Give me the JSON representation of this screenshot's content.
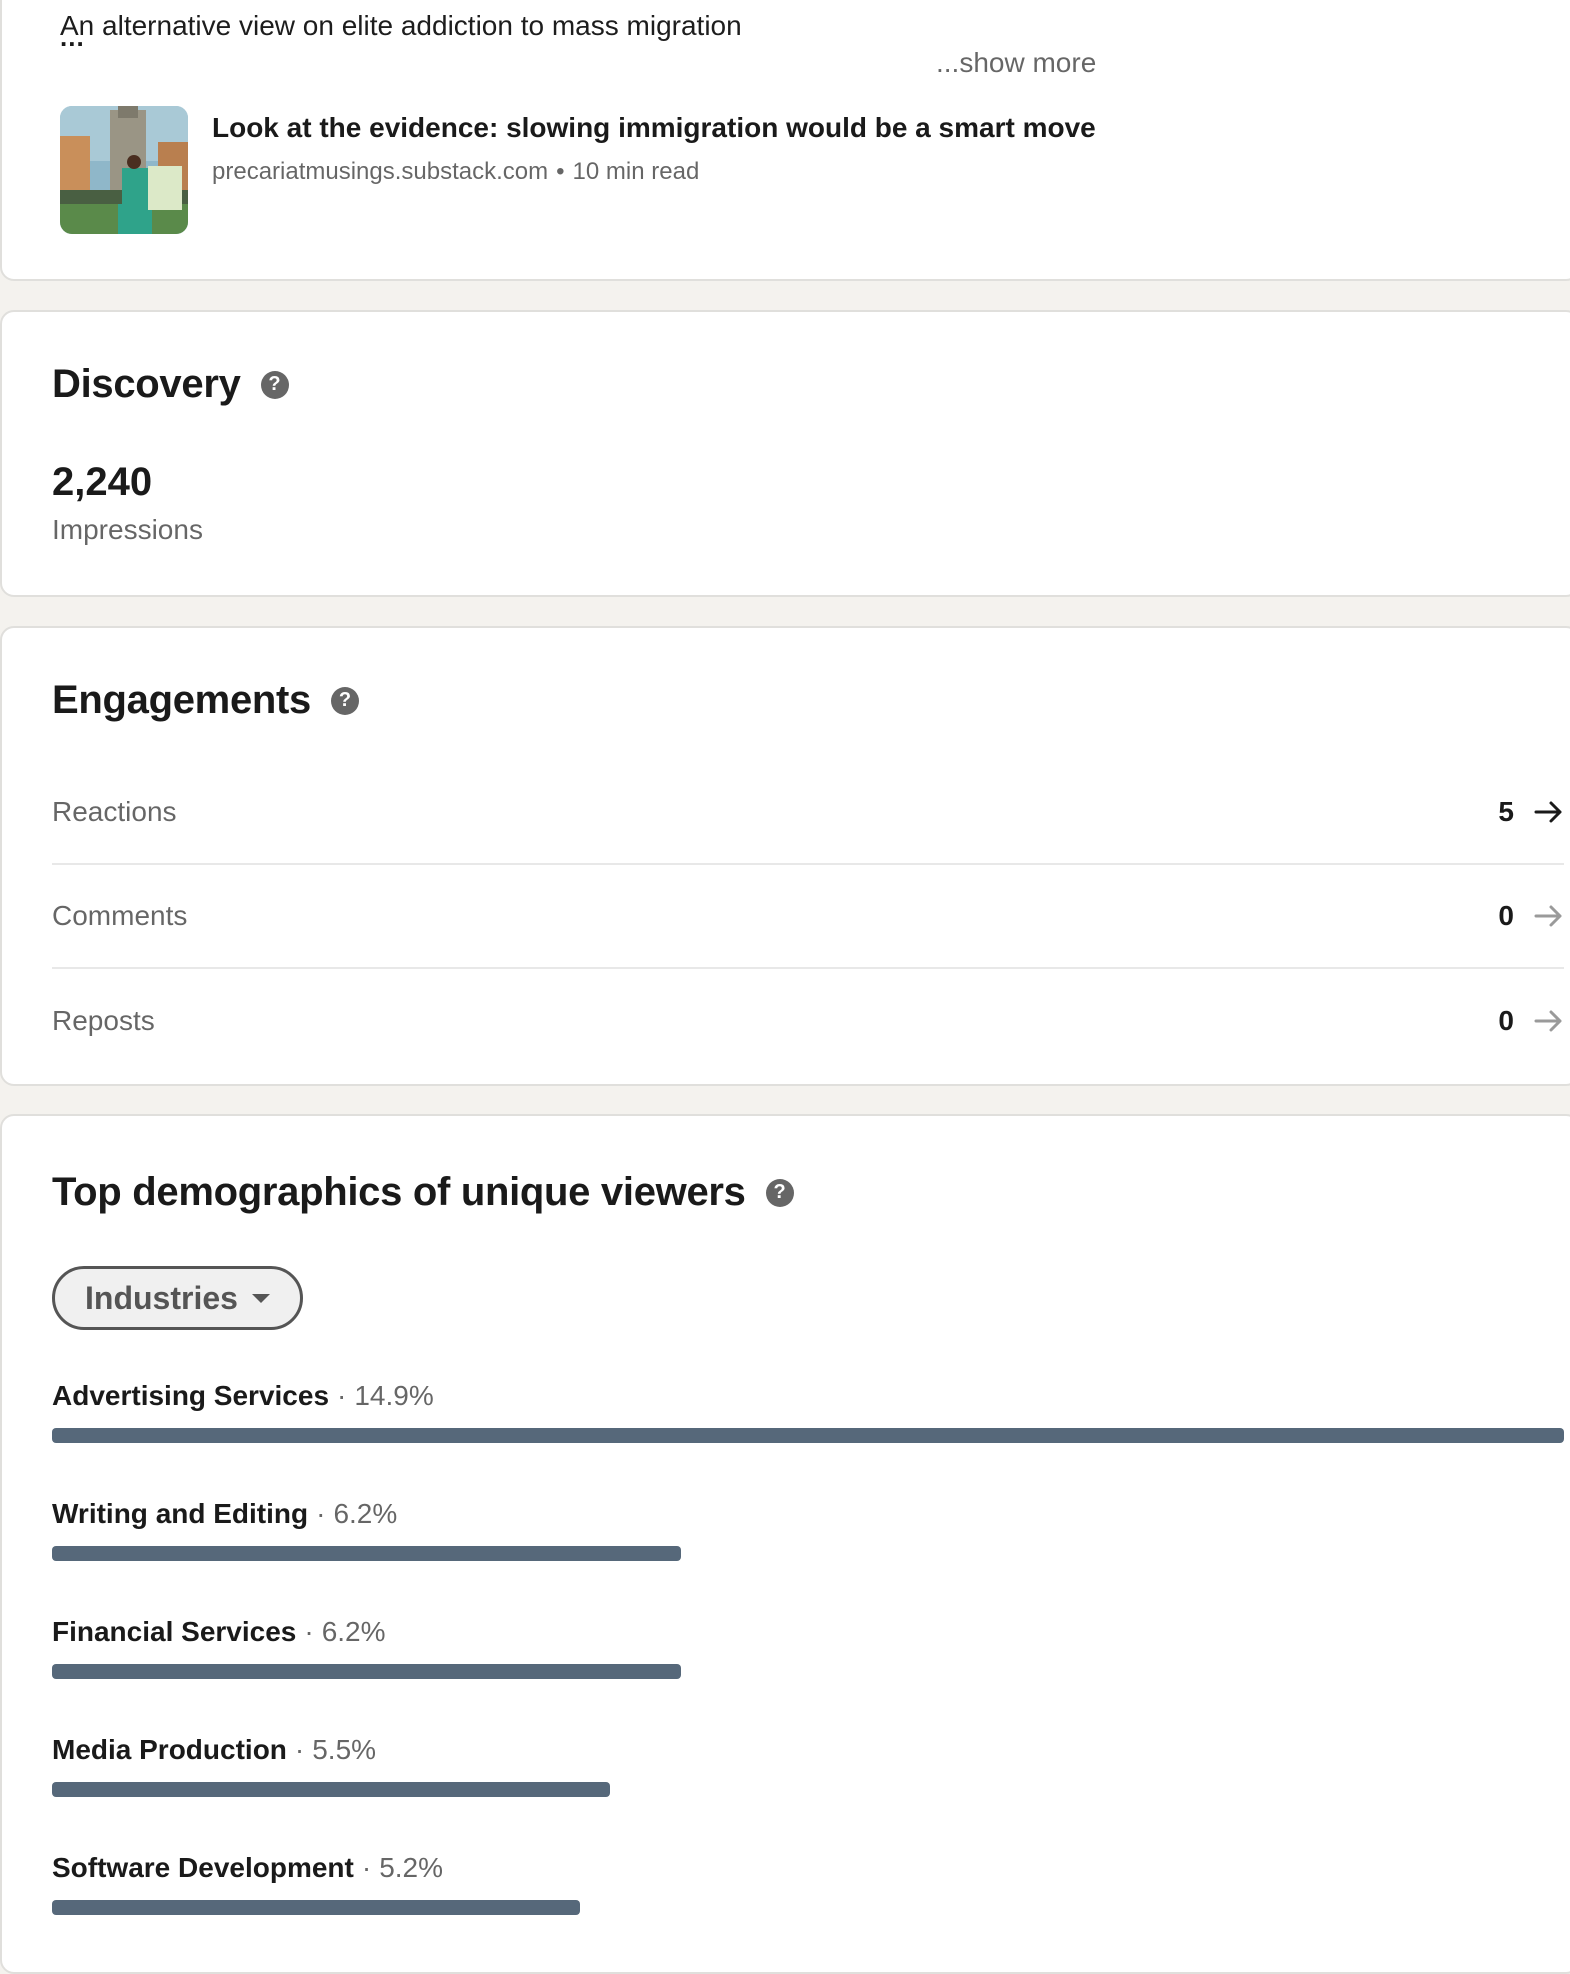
{
  "post": {
    "text": "An alternative view on elite addiction to mass migration",
    "ellipsis": "...",
    "show_more": "...show more",
    "article": {
      "title": "Look at the evidence: slowing immigration would be a smart move",
      "source": "precariatmusings.substack.com",
      "separator": "•",
      "read_time": "10 min read"
    }
  },
  "discovery": {
    "title": "Discovery",
    "help_icon": "?",
    "impressions_value": "2,240",
    "impressions_label": "Impressions"
  },
  "engagements": {
    "title": "Engagements",
    "help_icon": "?",
    "rows": [
      {
        "label": "Reactions",
        "value": "5",
        "icon": "arrow-right-icon",
        "arrow_color": "#1a1a1a"
      },
      {
        "label": "Comments",
        "value": "0",
        "icon": "arrow-right-icon",
        "arrow_color": "#9a9a9a"
      },
      {
        "label": "Reposts",
        "value": "0",
        "icon": "arrow-right-icon",
        "arrow_color": "#9a9a9a"
      }
    ]
  },
  "demographics": {
    "title": "Top demographics of unique viewers",
    "help_icon": "?",
    "filter": "Industries",
    "separator": "·",
    "bar_color": "#56687a",
    "items": [
      {
        "name": "Advertising Services",
        "percent": "14.9%",
        "share": 14.9
      },
      {
        "name": "Writing and Editing",
        "percent": "6.2%",
        "share": 6.2
      },
      {
        "name": "Financial Services",
        "percent": "6.2%",
        "share": 6.2
      },
      {
        "name": "Media Production",
        "percent": "5.5%",
        "share": 5.5
      },
      {
        "name": "Software Development",
        "percent": "5.2%",
        "share": 5.2
      }
    ]
  }
}
